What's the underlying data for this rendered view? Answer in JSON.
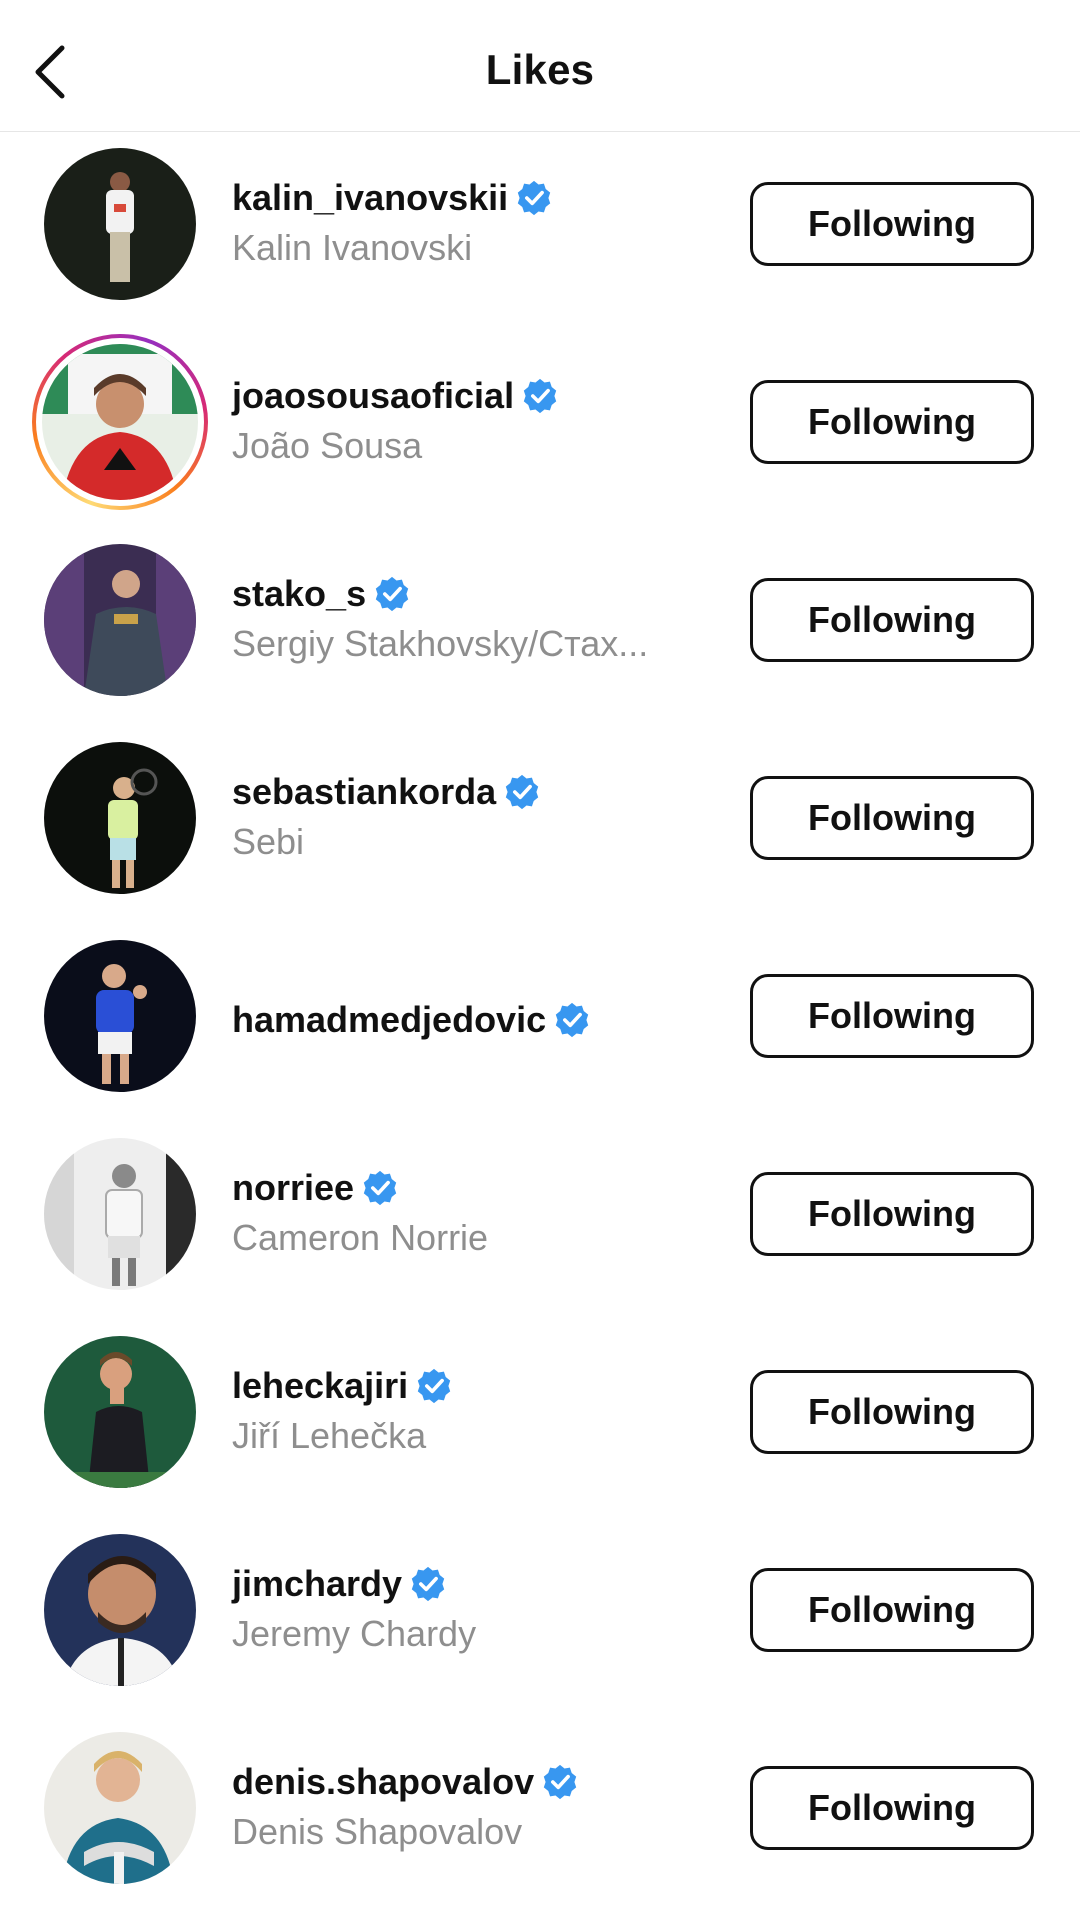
{
  "header": {
    "title": "Likes",
    "back_icon": "chevron-left-icon"
  },
  "colors": {
    "verified": "#3897f0",
    "secondary_text": "#8e8e8e",
    "story_ring": "#d62976"
  },
  "users": [
    {
      "username": "kalin_ivanovskii",
      "full_name": "Kalin Ivanovski",
      "verified": true,
      "button": "Following",
      "story": false
    },
    {
      "username": "joaosousaoficial",
      "full_name": "João Sousa",
      "verified": true,
      "button": "Following",
      "story": true
    },
    {
      "username": "stako_s",
      "full_name": "Sergiy Stakhovsky/Стах...",
      "verified": true,
      "button": "Following",
      "story": false
    },
    {
      "username": "sebastiankorda",
      "full_name": "Sebi",
      "verified": true,
      "button": "Following",
      "story": false
    },
    {
      "username": "hamadmedjedovic",
      "full_name": "",
      "verified": true,
      "button": "Following",
      "story": false
    },
    {
      "username": "norriee",
      "full_name": "Cameron Norrie",
      "verified": true,
      "button": "Following",
      "story": false
    },
    {
      "username": "leheckajiri",
      "full_name": "Jiří Lehečka",
      "verified": true,
      "button": "Following",
      "story": false
    },
    {
      "username": "jimchardy",
      "full_name": "Jeremy Chardy",
      "verified": true,
      "button": "Following",
      "story": false
    },
    {
      "username": "denis.shapovalov",
      "full_name": "Denis Shapovalov",
      "verified": true,
      "button": "Following",
      "story": false
    }
  ]
}
